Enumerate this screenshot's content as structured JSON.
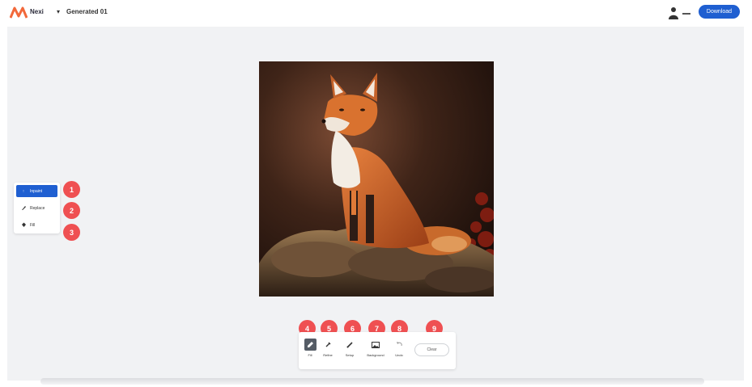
{
  "header": {
    "logo_text": "Nexi",
    "breadcrumb_label": "Generated 01",
    "download_label": "Download"
  },
  "left_panel": {
    "items": [
      {
        "label": "Inpaint",
        "icon": "arrow-icon",
        "active": true
      },
      {
        "label": "Replace",
        "icon": "brush-icon",
        "active": false
      },
      {
        "label": "Fill",
        "icon": "bucket-icon",
        "active": false
      }
    ]
  },
  "toolbar": {
    "tools": [
      {
        "label": "Fill",
        "icon": "pencil-icon",
        "selected": true
      },
      {
        "label": "Refine",
        "icon": "refine-icon",
        "selected": false
      },
      {
        "label": "Setup",
        "icon": "pen-icon",
        "selected": false
      },
      {
        "label": "Background",
        "icon": "image-icon",
        "selected": false
      },
      {
        "label": "Undo",
        "icon": "undo-icon",
        "selected": false
      }
    ],
    "clear_label": "Clear"
  },
  "badges": {
    "left": [
      "1",
      "2",
      "3"
    ],
    "bottom": [
      "4",
      "5",
      "6",
      "7",
      "8",
      "9"
    ]
  },
  "colors": {
    "accent": "#1f5fd1",
    "badge": "#ef5052",
    "canvas_bg": "#f1f2f4"
  }
}
